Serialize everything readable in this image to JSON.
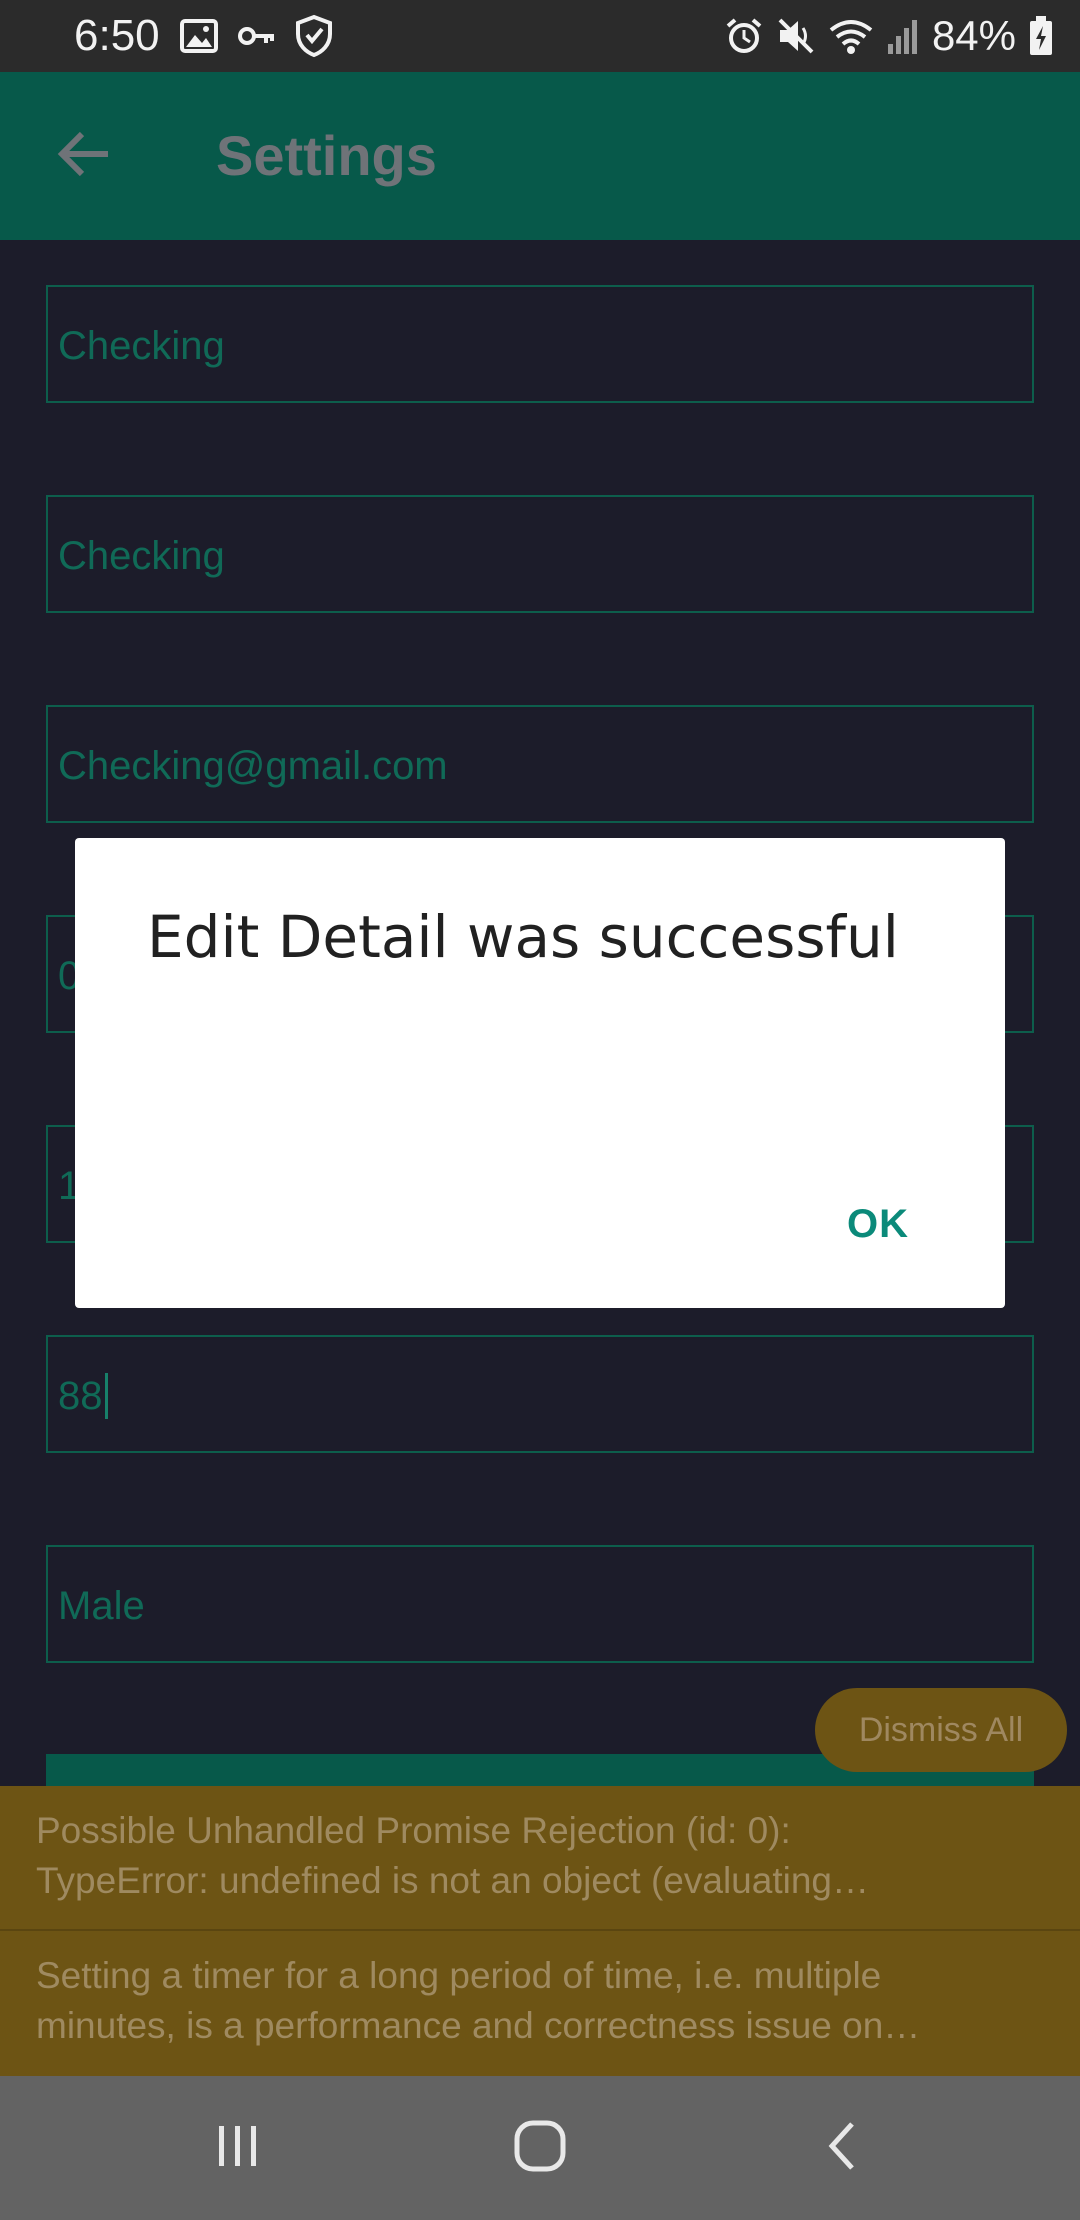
{
  "status_bar": {
    "time": "6:50",
    "battery": "84%",
    "left_icons": [
      "image-icon",
      "key-icon",
      "shield-icon"
    ],
    "right_icons": [
      "alarm-icon",
      "mute-icon",
      "wifi-icon",
      "signal-icon",
      "battery-icon"
    ]
  },
  "toolbar": {
    "title": "Settings",
    "back_icon": "arrow-back-icon"
  },
  "form": {
    "fields": [
      {
        "value": "Checking"
      },
      {
        "value": "Checking"
      },
      {
        "value": "Checking@gmail.com"
      },
      {
        "value": "0"
      },
      {
        "value": "1"
      },
      {
        "value": "88"
      },
      {
        "value": "Male"
      }
    ]
  },
  "warnings": {
    "dismiss_all": "Dismiss All",
    "items": [
      {
        "line1": "Possible Unhandled Promise Rejection (id: 0):",
        "line2": "TypeError: undefined is not an object (evaluating…"
      },
      {
        "line1": "Setting a timer for a long period of time, i.e. multiple",
        "line2": "minutes, is a performance and correctness issue on…"
      }
    ]
  },
  "dialog": {
    "title": "Edit Detail was successful",
    "ok_label": "OK"
  },
  "nav_bar": {
    "buttons": [
      "recent-apps-icon",
      "home-icon",
      "back-icon"
    ]
  },
  "colors": {
    "toolbar": "#07594a",
    "background": "#1c1c2a",
    "field_text": "#106a57",
    "warning": "#6d5414",
    "dialog_ok": "#0b8a7a"
  }
}
